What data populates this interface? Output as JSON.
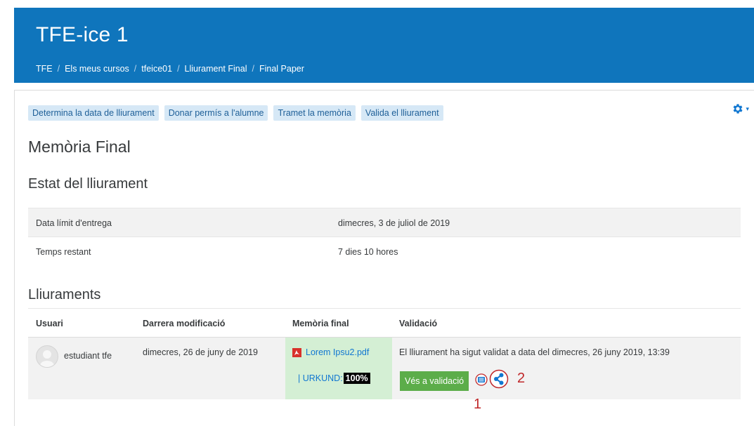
{
  "header": {
    "title": "TFE-ice 1",
    "breadcrumb": [
      "TFE",
      "Els meus cursos",
      "tfeice01",
      "Lliurament Final",
      "Final Paper"
    ],
    "separator": "/"
  },
  "actions": [
    "Determina la data de lliurament",
    "Donar permís a l'alumne",
    "Tramet la memòria",
    "Valida el lliurament"
  ],
  "gear_menu": {
    "icon": "gear-icon",
    "caret": "▾"
  },
  "page_title": "Memòria Final",
  "status": {
    "heading": "Estat del lliurament",
    "rows": [
      {
        "label": "Data límit d'entrega",
        "value": "dimecres, 3 de juliol de 2019"
      },
      {
        "label": "Temps restant",
        "value": "7 dies 10 hores"
      }
    ]
  },
  "submissions": {
    "heading": "Lliuraments",
    "columns": [
      "Usuari",
      "Darrera modificació",
      "Memòria final",
      "Validació"
    ],
    "rows": [
      {
        "user": "estudiant tfe",
        "modified": "dimecres, 26 de juny de 2019",
        "file": "Lorem Ipsu2.pdf",
        "urkund_label": "| URKUND:",
        "urkund_score": "100%",
        "validation_text": "El lliurament ha sigut validat a data del dimecres, 26 juny 2019, 13:39",
        "validation_button": "Vés a validació"
      }
    ]
  },
  "annotations": [
    "1",
    "2"
  ],
  "colors": {
    "header_bg": "#0f75bc",
    "link": "#1177d1",
    "button_green": "#5cad4a",
    "file_cell": "#d4efd4",
    "annotation": "#c0282a"
  }
}
